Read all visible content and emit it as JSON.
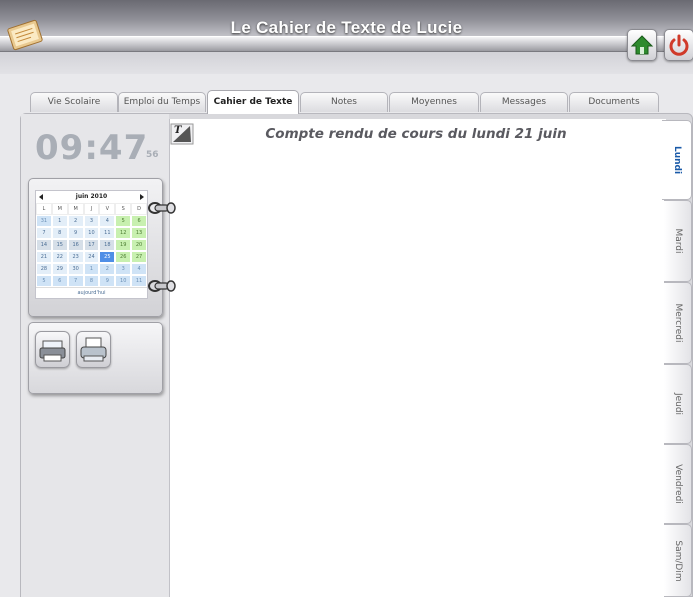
{
  "app": {
    "title": "Le Cahier de Texte de Lucie"
  },
  "tabs": [
    {
      "label": "Vie Scolaire"
    },
    {
      "label": "Emploi du Temps"
    },
    {
      "label": "Cahier de Texte"
    },
    {
      "label": "Notes"
    },
    {
      "label": "Moyennes"
    },
    {
      "label": "Messages"
    },
    {
      "label": "Documents"
    }
  ],
  "active_tab": "Cahier de Texte",
  "clock": {
    "time": "09:47",
    "seconds": "56"
  },
  "calendar": {
    "month": "juin 2010",
    "days_of_week": [
      "L",
      "M",
      "M",
      "J",
      "V",
      "S",
      "D"
    ],
    "weeks": [
      [
        "31",
        "1",
        "2",
        "3",
        "4",
        "5",
        "6"
      ],
      [
        "7",
        "8",
        "9",
        "10",
        "11",
        "12",
        "13"
      ],
      [
        "14",
        "15",
        "16",
        "17",
        "18",
        "19",
        "20"
      ],
      [
        "21",
        "22",
        "23",
        "24",
        "25",
        "26",
        "27"
      ],
      [
        "28",
        "29",
        "30",
        "1",
        "2",
        "3",
        "4"
      ],
      [
        "5",
        "6",
        "7",
        "8",
        "9",
        "10",
        "11"
      ]
    ],
    "today_label": "aujourd'hui",
    "selected_day": "25"
  },
  "content": {
    "heading": "Compte rendu de cours du lundi 21 juin"
  },
  "day_tabs": [
    {
      "label": "Lundi"
    },
    {
      "label": "Mardi"
    },
    {
      "label": "Mercredi"
    },
    {
      "label": "Jeudi"
    },
    {
      "label": "Vendredi"
    },
    {
      "label": "Sam/Dim"
    }
  ],
  "active_day": "Lundi",
  "icons": {
    "logo": "notebook-logo-icon",
    "home": "home-icon",
    "power": "power-icon",
    "print1": "print-icon",
    "print2": "printer-icon",
    "text_format": "text-format-icon"
  },
  "colors": {
    "accent": "#4f8ee6",
    "active_day": "#1a5aa8",
    "weekend": "#c8f0b0",
    "clock": "#a9aeb6",
    "home_green": "#2e8b2e",
    "power_red": "#d03a2a"
  }
}
